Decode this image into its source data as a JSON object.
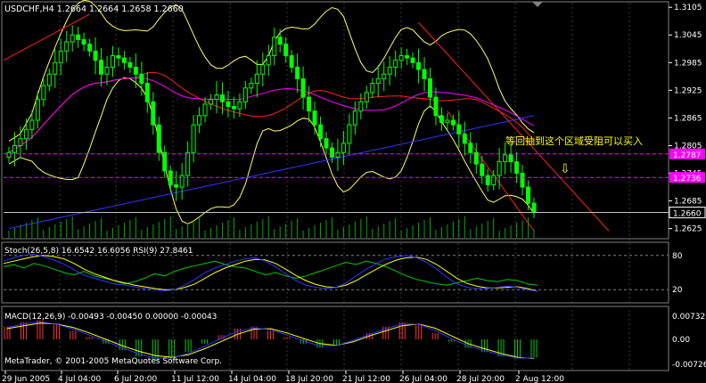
{
  "header": {
    "symbol_line": "USDCHF,H4  1.2664 1.2664 1.2658 1.2660"
  },
  "annotation": {
    "text": "等回抽到这个区域受阻可以买入",
    "arrow": "⇩"
  },
  "price_axis": {
    "ticks": [
      "1.3105",
      "1.3045",
      "1.2985",
      "1.2925",
      "1.2865",
      "1.2805",
      "1.2745",
      "1.2685",
      "1.2625"
    ],
    "level_labels": [
      "1.2787",
      "1.2736",
      "1.2660"
    ]
  },
  "stoch": {
    "label": "Stoch(26,5,8) 16.6542 16.6056  RSI(9) 27.8461",
    "ticks": [
      "80",
      "20"
    ]
  },
  "macd": {
    "label": "MACD(12,26,9) -0.00493 -0.00450 0.00000 -0.00043",
    "ticks": [
      "0.00732",
      "0.00",
      "-0.00726"
    ]
  },
  "copyright": "MetaTrader, © 2001-2005 MetaQuotes Software Corp.",
  "x_axis": {
    "labels": [
      "29 Jun 2005",
      "4 Jul 04:00",
      "6 Jul 20:00",
      "11 Jul 12:00",
      "14 Jul 04:00",
      "18 Jul 20:00",
      "21 Jul 12:00",
      "26 Jul 04:00",
      "28 Jul 20:00",
      "2 Aug 12:00"
    ]
  },
  "colors": {
    "bg": "#000000",
    "candles": "#00ff00",
    "bands": "#ffff66",
    "ma_red": "#ff2222",
    "ma_magenta": "#ff00ff",
    "ma_blue": "#3333ff",
    "level_line": "#ff00ff",
    "price_line": "#c0c0c0",
    "annotation": "#ffff00",
    "axis_text": "#ffffff",
    "grid": "#808080"
  },
  "chart_data": {
    "type": "candlestick",
    "symbol": "USDCHF",
    "timeframe": "H4",
    "ylim": [
      1.2605,
      1.3115
    ],
    "x_start": "29 Jun 2005",
    "x_end": "2 Aug 12:00",
    "last": {
      "open": 1.2664,
      "high": 1.2664,
      "low": 1.2658,
      "close": 1.266
    },
    "levels": [
      1.2787,
      1.2736
    ],
    "current_price": 1.266,
    "close_series": [
      1.279,
      1.2805,
      1.282,
      1.284,
      1.286,
      1.2905,
      1.2935,
      1.296,
      1.2985,
      1.301,
      1.303,
      1.3045,
      1.3035,
      1.3025,
      1.301,
      1.299,
      1.296,
      1.2975,
      1.3,
      1.2995,
      1.2985,
      1.2975,
      1.296,
      1.294,
      1.29,
      1.285,
      1.279,
      1.275,
      1.272,
      1.2715,
      1.274,
      1.279,
      1.285,
      1.287,
      1.2895,
      1.2905,
      1.2915,
      1.29,
      1.289,
      1.2885,
      1.29,
      1.293,
      1.294,
      1.296,
      1.298,
      1.3,
      1.304,
      1.3025,
      1.3,
      1.2975,
      1.295,
      1.291,
      1.288,
      1.285,
      1.282,
      1.28,
      1.278,
      1.279,
      1.281,
      1.285,
      1.288,
      1.29,
      1.292,
      1.294,
      1.295,
      1.296,
      1.2975,
      1.299,
      1.3,
      1.2995,
      1.2985,
      1.297,
      1.295,
      1.291,
      1.287,
      1.2855,
      1.286,
      1.285,
      1.283,
      1.281,
      1.279,
      1.2765,
      1.274,
      1.272,
      1.274,
      1.277,
      1.2785,
      1.277,
      1.2745,
      1.2715,
      1.268,
      1.266
    ],
    "stoch_k": [
      70,
      76,
      80,
      82,
      78,
      72,
      65,
      55,
      45,
      40,
      35,
      30,
      28,
      25,
      22,
      20,
      18,
      20,
      28,
      38,
      50,
      58,
      64,
      70,
      74,
      76,
      70,
      60,
      48,
      36,
      28,
      24,
      22,
      24,
      32,
      44,
      56,
      66,
      74,
      78,
      80,
      76,
      68,
      56,
      42,
      30,
      24,
      22,
      22,
      24,
      26,
      24,
      20,
      17
    ],
    "stoch_d": [
      66,
      70,
      74,
      78,
      80,
      78,
      74,
      66,
      56,
      48,
      42,
      36,
      32,
      28,
      25,
      22,
      20,
      20,
      24,
      30,
      40,
      50,
      58,
      64,
      70,
      73,
      72,
      66,
      56,
      45,
      36,
      29,
      25,
      24,
      28,
      36,
      46,
      56,
      65,
      72,
      76,
      77,
      73,
      64,
      52,
      40,
      31,
      26,
      23,
      23,
      24,
      25,
      22,
      17
    ],
    "rsi": [
      60,
      64,
      58,
      66,
      62,
      56,
      50,
      46,
      52,
      44,
      40,
      36,
      30,
      34,
      40,
      48,
      44,
      52,
      58,
      62,
      66,
      70,
      64,
      60,
      58,
      52,
      46,
      50,
      44,
      40,
      44,
      50,
      56,
      62,
      68,
      64,
      70,
      66,
      60,
      52,
      44,
      38,
      34,
      30,
      28,
      32,
      36,
      40,
      36,
      34,
      38,
      36,
      30,
      27.8
    ],
    "macd_hist": [
      0.003,
      0.004,
      0.0045,
      0.0035,
      0.002,
      0.0005,
      -0.001,
      -0.0025,
      -0.004,
      -0.005,
      -0.0045,
      -0.003,
      -0.001,
      0.001,
      0.0025,
      0.003,
      0.002,
      0.0005,
      -0.001,
      -0.002,
      -0.0015,
      0.0,
      0.0015,
      0.003,
      0.004,
      0.0035,
      0.0015,
      -0.0005,
      -0.002,
      -0.003,
      -0.004,
      -0.0045,
      -0.0043
    ],
    "macd_signal": [
      0.0025,
      0.0032,
      0.0038,
      0.0036,
      0.0028,
      0.0015,
      0.0,
      -0.0015,
      -0.0028,
      -0.0038,
      -0.0042,
      -0.0036,
      -0.0022,
      -0.0005,
      0.0012,
      0.0024,
      0.0025,
      0.0015,
      0.0002,
      -0.001,
      -0.0014,
      -0.0006,
      0.0008,
      0.002,
      0.0032,
      0.0036,
      0.0026,
      0.0008,
      -0.001,
      -0.0022,
      -0.0033,
      -0.0042,
      -0.0045
    ]
  }
}
